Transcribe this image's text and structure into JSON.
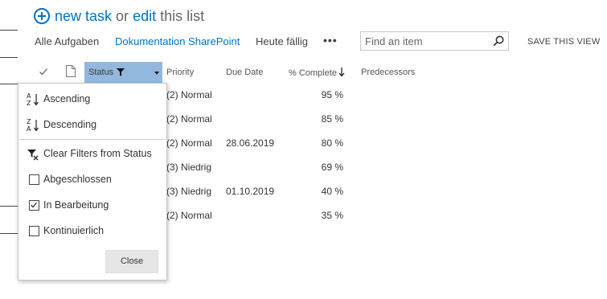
{
  "header": {
    "new_task_label": "new task",
    "or_label": "or",
    "edit_label": "edit",
    "this_list_label": "this list"
  },
  "views": {
    "tabs": [
      {
        "label": "Alle Aufgaben"
      },
      {
        "label": "Dokumentation SharePoint"
      },
      {
        "label": "Heute fällig"
      }
    ],
    "more_label": "•••",
    "save_view_label": "SAVE THIS VIEW"
  },
  "search": {
    "placeholder": "Find an item",
    "value": ""
  },
  "columns": {
    "status": "Status",
    "priority": "Priority",
    "due_date": "Due Date",
    "percent_complete": "% Complete",
    "predecessors": "Predecessors"
  },
  "rows": [
    {
      "priority": "(2) Normal",
      "due_date": "",
      "percent_complete": "95 %"
    },
    {
      "priority": "(2) Normal",
      "due_date": "",
      "percent_complete": "85 %"
    },
    {
      "priority": "(2) Normal",
      "due_date": "28.06.2019",
      "percent_complete": "80 %"
    },
    {
      "priority": "(3) Niedrig",
      "due_date": "",
      "percent_complete": "69 %"
    },
    {
      "priority": "(3) Niedrig",
      "due_date": "01.10.2019",
      "percent_complete": "40 %"
    },
    {
      "priority": "(2) Normal",
      "due_date": "",
      "percent_complete": "35 %"
    }
  ],
  "filter_menu": {
    "ascending_label": "Ascending",
    "descending_label": "Descending",
    "clear_filters_label": "Clear Filters from Status",
    "options": [
      {
        "label": "Abgeschlossen",
        "checked": false
      },
      {
        "label": "In Bearbeitung",
        "checked": true
      },
      {
        "label": "Kontinuierlich",
        "checked": false
      }
    ],
    "close_label": "Close"
  },
  "colors": {
    "accent": "#0072c6",
    "status_header_bg": "#92b8dd",
    "close_button_bg": "#e6e6e6"
  }
}
